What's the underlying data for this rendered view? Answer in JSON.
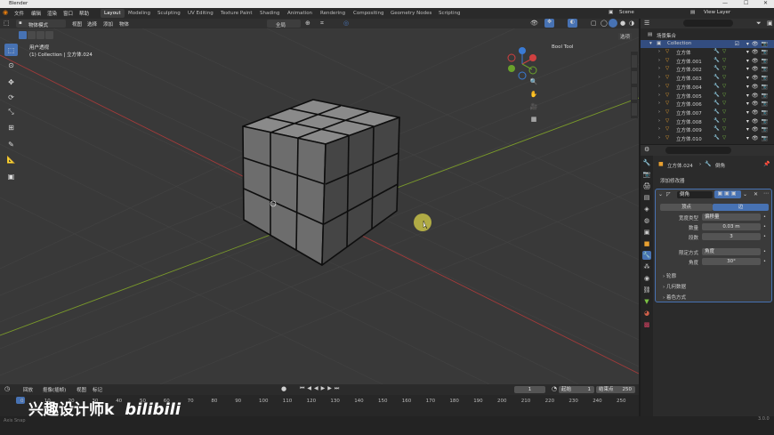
{
  "app": {
    "title": "Blender"
  },
  "menu": [
    "文件",
    "编辑",
    "渲染",
    "窗口",
    "帮助"
  ],
  "workspaces": [
    "Layout",
    "Modeling",
    "Sculpting",
    "UV Editing",
    "Texture Paint",
    "Shading",
    "Animation",
    "Rendering",
    "Compositing",
    "Geometry Nodes",
    "Scripting"
  ],
  "scene": {
    "name": "Scene",
    "view_layer": "View Layer"
  },
  "vp_header": {
    "mode": "物体模式",
    "view": "视图",
    "select": "选择",
    "add": "添加",
    "object": "物体",
    "orientation": "全局"
  },
  "viewport": {
    "view_name": "用户透视",
    "collection_line": "(1) Collection | 立方体.024",
    "bool_tool": "Bool Tool",
    "options": "选项"
  },
  "outliner": {
    "title": "场景集合",
    "collection": "Collection",
    "items": [
      "立方体",
      "立方体.001",
      "立方体.002",
      "立方体.003",
      "立方体.004",
      "立方体.005",
      "立方体.006",
      "立方体.007",
      "立方体.008",
      "立方体.009",
      "立方体.010"
    ]
  },
  "properties": {
    "object_name": "立方体.024",
    "modifier_type": "倒角",
    "add_modifier": "添加修改器",
    "modifier_name": "倒角",
    "vertices_tab": "顶点",
    "edges_tab": "边",
    "width_type_label": "宽度类型",
    "width_type": "偏移量",
    "amount_label": "数量",
    "amount": "0.03 m",
    "segments_label": "段数",
    "segments": "3",
    "limit_label": "限定方式",
    "limit": "角度",
    "angle_label": "角度",
    "angle": "30°",
    "sections": [
      "轮廓",
      "几何数据",
      "着色方式"
    ]
  },
  "timeline": {
    "playback": "回放",
    "keying": "抠像(插帧)",
    "view": "视图",
    "marker": "标记",
    "current_frame": "1",
    "start_label": "起始",
    "start": "1",
    "end_label": "结束点",
    "end": "250",
    "ticks": [
      "0",
      "10",
      "20",
      "30",
      "40",
      "50",
      "60",
      "70",
      "80",
      "90",
      "100",
      "110",
      "120",
      "130",
      "140",
      "150",
      "160",
      "170",
      "180",
      "190",
      "200",
      "210",
      "220",
      "230",
      "240",
      "250"
    ]
  },
  "status": {
    "version": "3.0.0",
    "left_hint": "Axis Snap"
  },
  "watermark": {
    "text": "兴趣设计师k",
    "brand": "bilibili"
  },
  "colors": {
    "accent": "#4772b3",
    "viewport_bg": "#393939",
    "panel_bg": "#2b2b2b",
    "x_axis": "#a33a3a",
    "y_axis": "#7a9a2a"
  }
}
